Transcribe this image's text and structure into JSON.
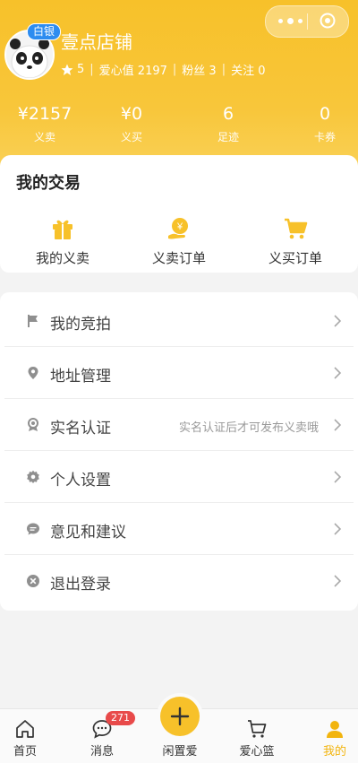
{
  "header": {
    "shop_name": "壹点店铺",
    "level_badge": "白银",
    "stats": {
      "stars": "5",
      "love": "爱心值 2197",
      "fans": "粉丝 3",
      "follow": "关注 0"
    },
    "capsule_icons": [
      "more-dots-icon",
      "close-target-icon"
    ]
  },
  "summary": [
    {
      "value": "¥2157",
      "label": "义卖"
    },
    {
      "value": "¥0",
      "label": "义买"
    },
    {
      "value": "6",
      "label": "足迹"
    },
    {
      "value": "0",
      "label": "卡券"
    }
  ],
  "trade": {
    "title": "我的交易",
    "items": [
      {
        "label": "我的义卖",
        "icon": "gift-icon"
      },
      {
        "label": "义卖订单",
        "icon": "coin-hand-icon"
      },
      {
        "label": "义买订单",
        "icon": "cart-icon"
      }
    ]
  },
  "menu": [
    {
      "label": "我的竞拍",
      "icon": "flag-icon",
      "hint": ""
    },
    {
      "label": "地址管理",
      "icon": "location-icon",
      "hint": ""
    },
    {
      "label": "实名认证",
      "icon": "badge-icon",
      "hint": "实名认证后才可发布义卖哦"
    },
    {
      "label": "个人设置",
      "icon": "gear-icon",
      "hint": ""
    },
    {
      "label": "意见和建议",
      "icon": "chat-icon",
      "hint": ""
    },
    {
      "label": "退出登录",
      "icon": "close-circle-icon",
      "hint": ""
    }
  ],
  "tabbar": {
    "tabs": [
      {
        "label": "首页",
        "icon": "home-icon"
      },
      {
        "label": "消息",
        "icon": "message-icon"
      },
      {
        "label": "闲置爱",
        "icon": "plus-icon"
      },
      {
        "label": "爱心篮",
        "icon": "basket-icon"
      },
      {
        "label": "我的",
        "icon": "user-icon"
      }
    ],
    "message_badge": "271",
    "active_tab": "我的"
  },
  "colors": {
    "accent": "#f7c12a",
    "active_tab": "#f2b40d",
    "badge_blue": "#2d8cf0",
    "badge_red": "#e84a4a"
  }
}
